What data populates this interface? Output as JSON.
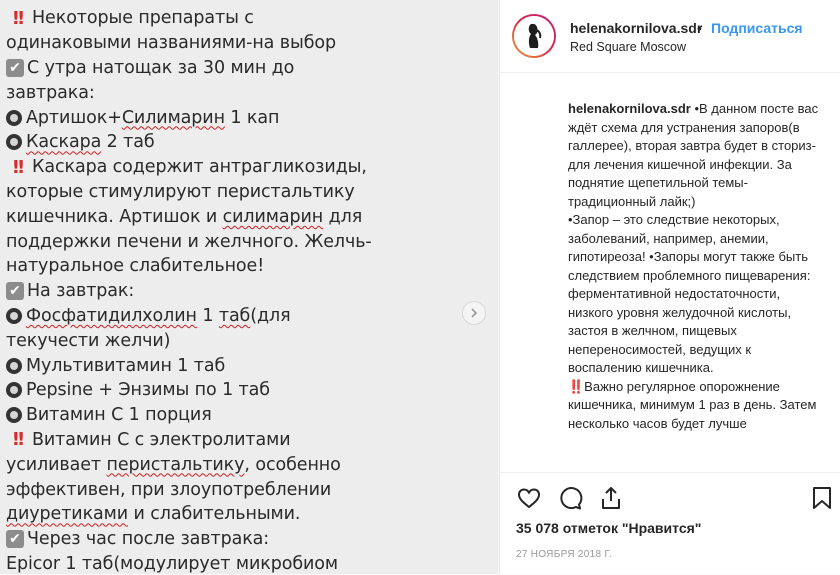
{
  "post_image": {
    "lines": [
      {
        "icon": "exclamation",
        "segments": [
          {
            "t": "Некоторые препараты с"
          }
        ]
      },
      {
        "icon": null,
        "segments": [
          {
            "t": "одинаковыми названиями-на выбор"
          }
        ]
      },
      {
        "icon": "check",
        "segments": [
          {
            "t": "С утра натощак за 30 мин до"
          }
        ]
      },
      {
        "icon": null,
        "segments": [
          {
            "t": "завтрака:"
          }
        ]
      },
      {
        "icon": "radio",
        "segments": [
          {
            "t": "Артишок+"
          },
          {
            "t": "Силимарин",
            "u": true
          },
          {
            "t": " 1 кап"
          }
        ]
      },
      {
        "icon": "radio",
        "segments": [
          {
            "t": "Каскара",
            "u": true
          },
          {
            "t": "  2 таб"
          }
        ]
      },
      {
        "icon": "exclamation",
        "segments": [
          {
            "t": "Каскара содержит антрагликозиды,"
          }
        ]
      },
      {
        "icon": null,
        "segments": [
          {
            "t": "которые стимулируют перистальтику"
          }
        ]
      },
      {
        "icon": null,
        "segments": [
          {
            "t": "кишечника. Артишок и "
          },
          {
            "t": "силимарин",
            "u": true
          },
          {
            "t": " для"
          }
        ]
      },
      {
        "icon": null,
        "segments": [
          {
            "t": "поддержки печени и желчного. Желчь-"
          }
        ]
      },
      {
        "icon": null,
        "segments": [
          {
            "t": "натуральное слабительное!"
          }
        ]
      },
      {
        "icon": "check",
        "segments": [
          {
            "t": "На завтрак:"
          }
        ]
      },
      {
        "icon": "radio",
        "segments": [
          {
            "t": "Фосфатидилхолин",
            "u": true
          },
          {
            "t": " 1 "
          },
          {
            "t": "таб",
            "u": true
          },
          {
            "t": "(для"
          }
        ]
      },
      {
        "icon": null,
        "segments": [
          {
            "t": "текучести желчи)"
          }
        ]
      },
      {
        "icon": "radio",
        "segments": [
          {
            "t": "Мультивитамин 1 таб"
          }
        ]
      },
      {
        "icon": "radio",
        "segments": [
          {
            "t": "Pepsine + Энзимы по 1 таб"
          }
        ]
      },
      {
        "icon": "radio",
        "segments": [
          {
            "t": "Витамин С 1 порция"
          }
        ]
      },
      {
        "icon": "exclamation",
        "segments": [
          {
            "t": "Витамин С с электролитами"
          }
        ]
      },
      {
        "icon": null,
        "segments": [
          {
            "t": "усиливает "
          },
          {
            "t": "перистальтику",
            "u": true
          },
          {
            "t": ", особенно"
          }
        ]
      },
      {
        "icon": null,
        "segments": [
          {
            "t": "эффективен, при злоупотреблении"
          }
        ]
      },
      {
        "icon": null,
        "segments": [
          {
            "t": "диуретиками",
            "u": true
          },
          {
            "t": " и слабительными."
          }
        ]
      },
      {
        "icon": "check",
        "segments": [
          {
            "t": "Через час после завтрака:"
          }
        ]
      },
      {
        "icon": null,
        "segments": [
          {
            "t": "Epicor 1 таб(модулирует микробиом"
          }
        ]
      }
    ]
  },
  "header": {
    "username": "helenakornilova.sdr",
    "separator": "•",
    "follow_label": "Подписаться",
    "location": "Red Square Moscow"
  },
  "caption": {
    "username": "helenakornilova.sdr",
    "paragraphs": [
      "•В данном посте вас ждёт схема для устранения запоров(в галлерее), вторая завтра будет в сториз-для лечения кишечной инфекции. За поднятие щепетильной темы-традиционный лайк;)",
      "•Запор – это следствие некоторых, заболеваний, например, анемии, гипотиреоза! •Запоры могут также быть следствием проблемного пищеварения: ферментативной недостаточности, низкого уровня желудочной кислоты, застоя в желчном, пищевых непереносимостей, ведущих к воспалению кишечника.",
      "‼️Важно регулярное опорожнение кишечника, минимум 1 раз в день. Затем несколько часов будет лучше"
    ]
  },
  "actions": {
    "like_icon": "heart-icon",
    "comment_icon": "comment-icon",
    "share_icon": "share-icon",
    "save_icon": "bookmark-icon"
  },
  "likes": "35 078 отметок \"Нравится\"",
  "date": "27 НОЯБРЯ 2018 Г.",
  "colors": {
    "accent": "#3897f0",
    "text": "#262626",
    "muted": "#999999",
    "image_bg": "#ededed",
    "exclamation": "#d42c2c"
  }
}
